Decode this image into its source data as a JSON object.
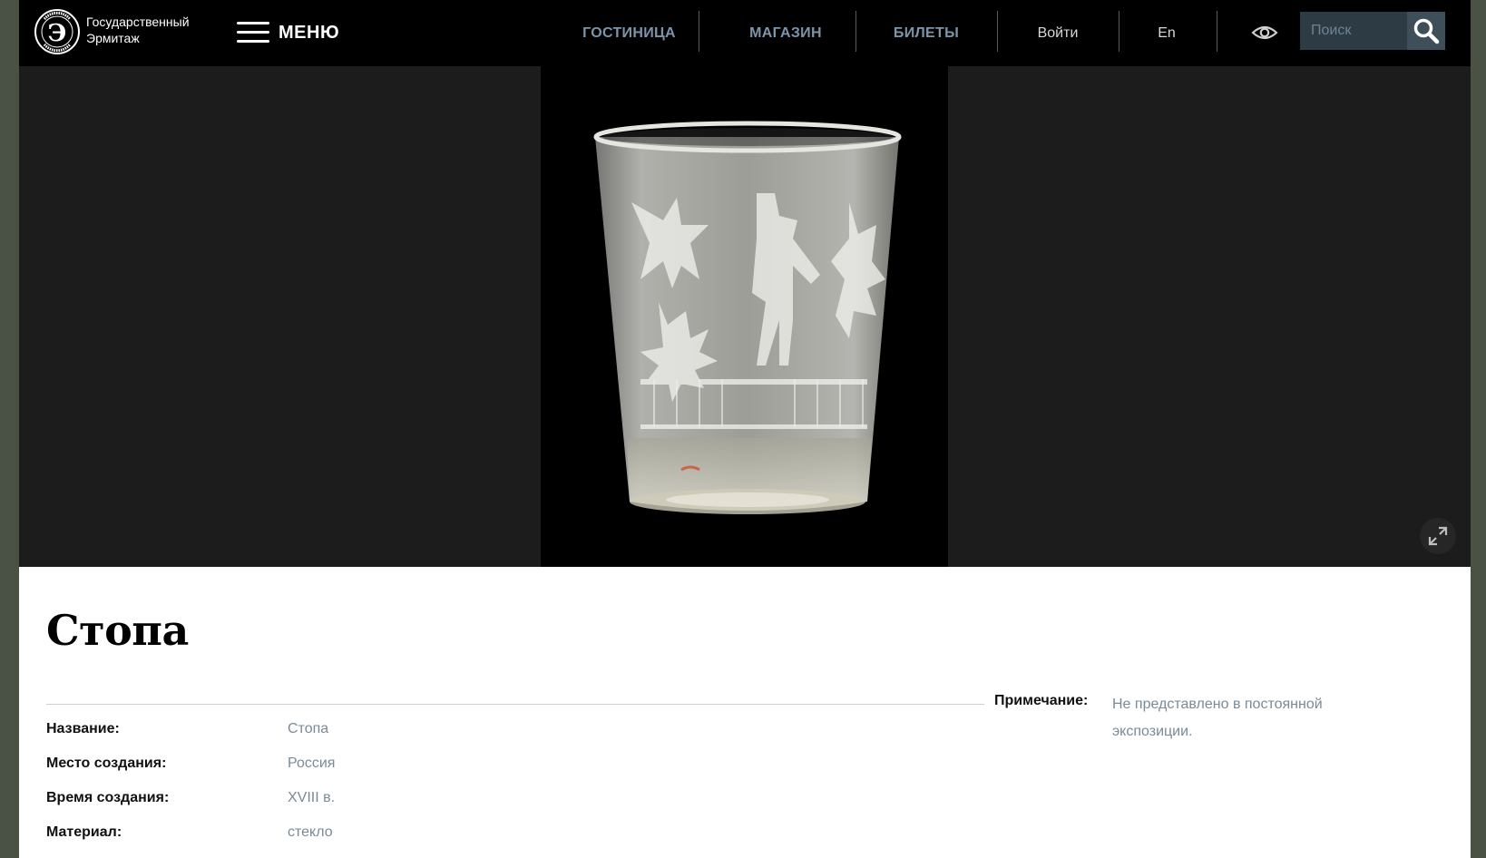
{
  "header": {
    "logo_line1": "Государственный",
    "logo_line2": "Эрмитаж",
    "logo_ring_text": "ГОСУДАРСТВЕННЫЙ ЭРМИТАЖ",
    "menu_label": "МЕНЮ",
    "nav": {
      "hotel": "ГОСТИНИЦА",
      "shop": "МАГАЗИН",
      "tickets": "БИЛЕТЫ",
      "login": "Войти",
      "lang": "En"
    },
    "search_placeholder": "Поиск"
  },
  "icons": {
    "logo": "hermitage-logo",
    "menu": "hamburger-icon",
    "accessibility": "eye-icon",
    "search": "search-icon",
    "expand": "expand-icon"
  },
  "colors": {
    "nav_accent": "#7c95aa",
    "value_text": "#7a8a96",
    "search_bg": "#2d3b44"
  },
  "item": {
    "title": "Стопа",
    "fields": [
      {
        "label": "Название:",
        "value": "Стопа"
      },
      {
        "label": "Место создания:",
        "value": "Россия"
      },
      {
        "label": "Время создания:",
        "value": "XVIII в."
      },
      {
        "label": "Материал:",
        "value": "стекло"
      }
    ],
    "note_label": "Примечание:",
    "note_value": "Не представлено в постоянной экспозиции."
  }
}
